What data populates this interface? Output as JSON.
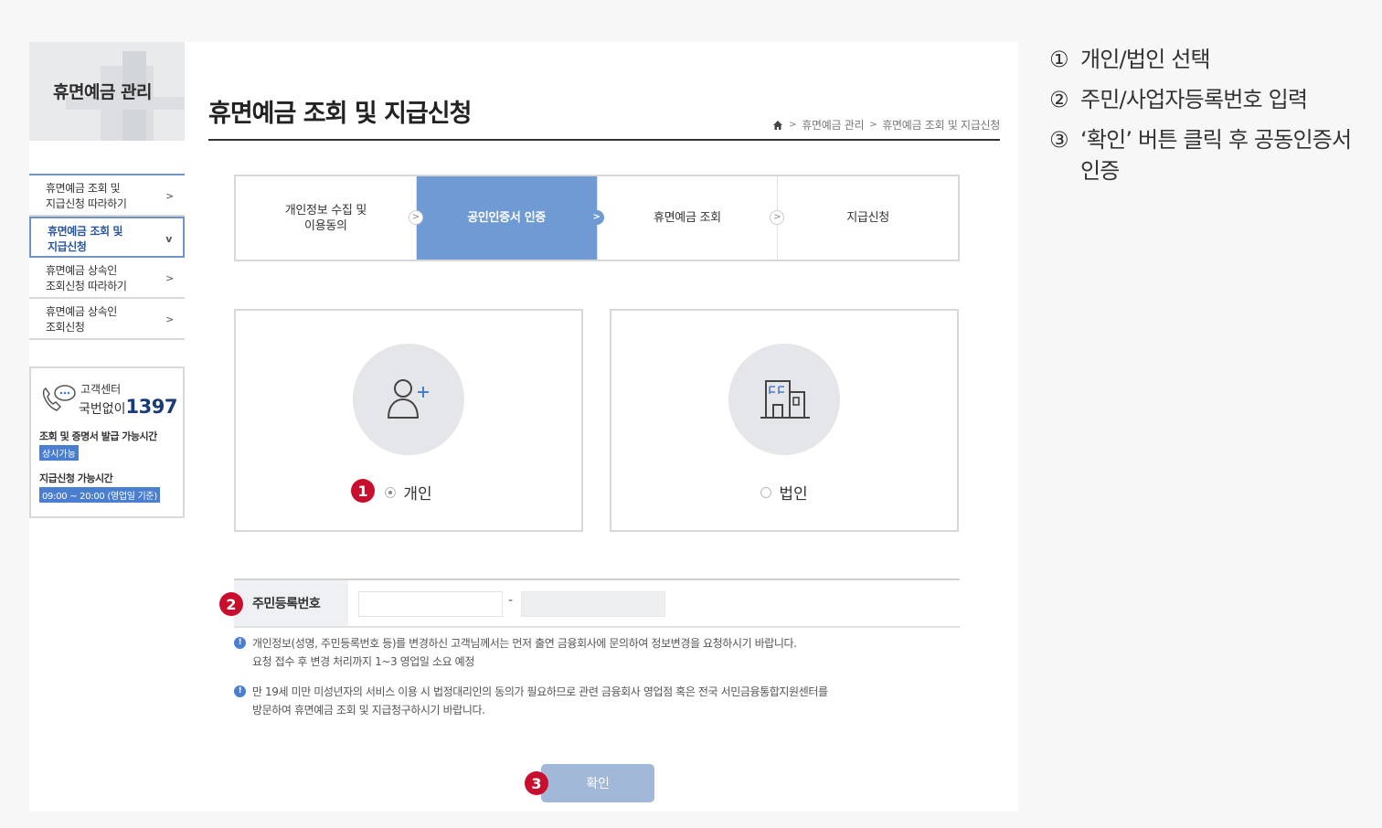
{
  "sidebar": {
    "title": "휴면예금 관리",
    "items": [
      {
        "label_line1": "휴면예금 조회 및",
        "label_line2": "지급신청 따라하기",
        "chevron": ">"
      },
      {
        "label_line1": "휴면예금 조회 및",
        "label_line2": "지급신청",
        "chevron": "v"
      },
      {
        "label_line1": "휴면예금 상속인",
        "label_line2": "조회신청 따라하기",
        "chevron": ">"
      },
      {
        "label_line1": "휴면예금 상속인",
        "label_line2": "조회신청",
        "chevron": ">"
      }
    ],
    "customer_center": {
      "label": "고객센터",
      "prefix": "국번없이",
      "number": "1397",
      "hours_title": "조회 및 증명서 발급 가능시간",
      "hours_badge": "상시가능",
      "apply_title": "지급신청 가능시간",
      "apply_badge": "09:00 ~ 20:00 (영업일 기준)"
    }
  },
  "header": {
    "title": "휴면예금 조회 및 지급신청",
    "breadcrumb": [
      "휴면예금 관리",
      "휴면예금 조회 및 지급신청"
    ],
    "breadcrumb_sep": ">"
  },
  "steps": [
    {
      "line1": "개인정보 수집 및",
      "line2": "이용동의",
      "arrow": ">"
    },
    {
      "line1": "공인인증서 인증",
      "line2": "",
      "arrow": ">"
    },
    {
      "line1": "휴면예금 조회",
      "line2": "",
      "arrow": ">"
    },
    {
      "line1": "지급신청",
      "line2": ""
    }
  ],
  "user_type": {
    "personal_label": "개인",
    "corporate_label": "법인",
    "selected": "personal"
  },
  "id_row": {
    "label": "주민등록번호",
    "part1_value": "",
    "part2_value": "",
    "dash": "-"
  },
  "notices": [
    {
      "line1": "개인정보(성명, 주민등록번호 등)를 변경하신 고객님께서는 먼저 출연 금융회사에 문의하여 정보변경을 요청하시기 바랍니다.",
      "line2": "요청 접수 후 변경 처리까지 1~3 영업일 소요 예정"
    },
    {
      "line1": "만 19세 미만 미성년자의 서비스 이용 시 법정대리인의 동의가 필요하므로 관련 금융회사 영업점 혹은 전국 서민금융통합지원센터를",
      "line2": "방문하여 휴면예금 조회 및 지급청구하시기 바랍니다."
    }
  ],
  "confirm_label": "확인",
  "badges": [
    "1",
    "2",
    "3"
  ],
  "instructions": [
    {
      "num": "①",
      "text": "개인/법인 선택"
    },
    {
      "num": "②",
      "text": "주민/사업자등록번호 입력"
    },
    {
      "num": "③",
      "text": "‘확인’ 버튼 클릭 후 공동인증서 인증"
    }
  ],
  "colors": {
    "accent": "#6f9ad3",
    "badge": "#c8102e",
    "button": "#a2b8d8",
    "link_blue": "#2a55a0"
  }
}
